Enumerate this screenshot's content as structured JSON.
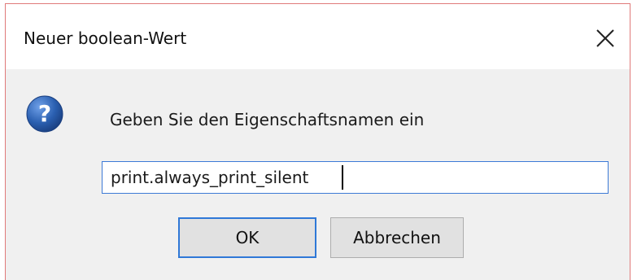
{
  "dialog": {
    "title": "Neuer boolean-Wert",
    "close_icon": "close-icon",
    "question_icon": "question-icon",
    "prompt": "Geben Sie den Eigenschaftsnamen ein",
    "input": {
      "value": "print.always_print_silent",
      "placeholder": ""
    },
    "buttons": {
      "ok_label": "OK",
      "cancel_label": "Abbrechen"
    }
  },
  "colors": {
    "window_border": "#e07a7a",
    "accent": "#2f78d7",
    "body_background": "#f0f0f0",
    "title_background": "#ffffff",
    "question_icon": "#2a5fb0"
  }
}
